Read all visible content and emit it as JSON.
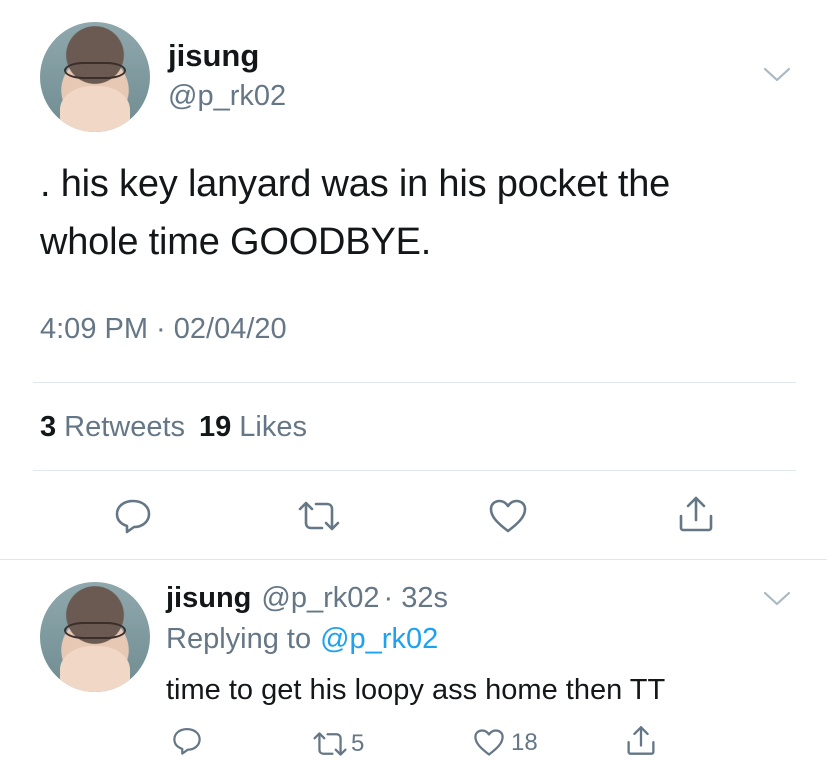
{
  "main_tweet": {
    "display_name": "jisung",
    "handle": "@p_rk02",
    "text_line1": ". his key lanyard was in his pocket the",
    "text_line2": "whole time GOODBYE.",
    "timestamp": "4:09 PM · 02/04/20",
    "retweets_count": "3",
    "retweets_label": "Retweets",
    "likes_count": "19",
    "likes_label": "Likes",
    "icons": [
      "reply-icon",
      "retweet-icon",
      "like-icon",
      "share-icon"
    ]
  },
  "reply_tweet": {
    "display_name": "jisung",
    "handle": "@p_rk02",
    "time": "· 32s",
    "replying_prefix": "Replying to",
    "replying_handle": "@p_rk02",
    "text": "time to get his loopy ass home then TT",
    "retweet_count": "5",
    "like_count": "18",
    "icons": [
      "reply-icon",
      "retweet-icon",
      "like-icon",
      "share-icon"
    ]
  },
  "colors": {
    "text": "#14171a",
    "secondary": "#657786",
    "link": "#1da1f2",
    "divider": "#e1e8ed"
  }
}
